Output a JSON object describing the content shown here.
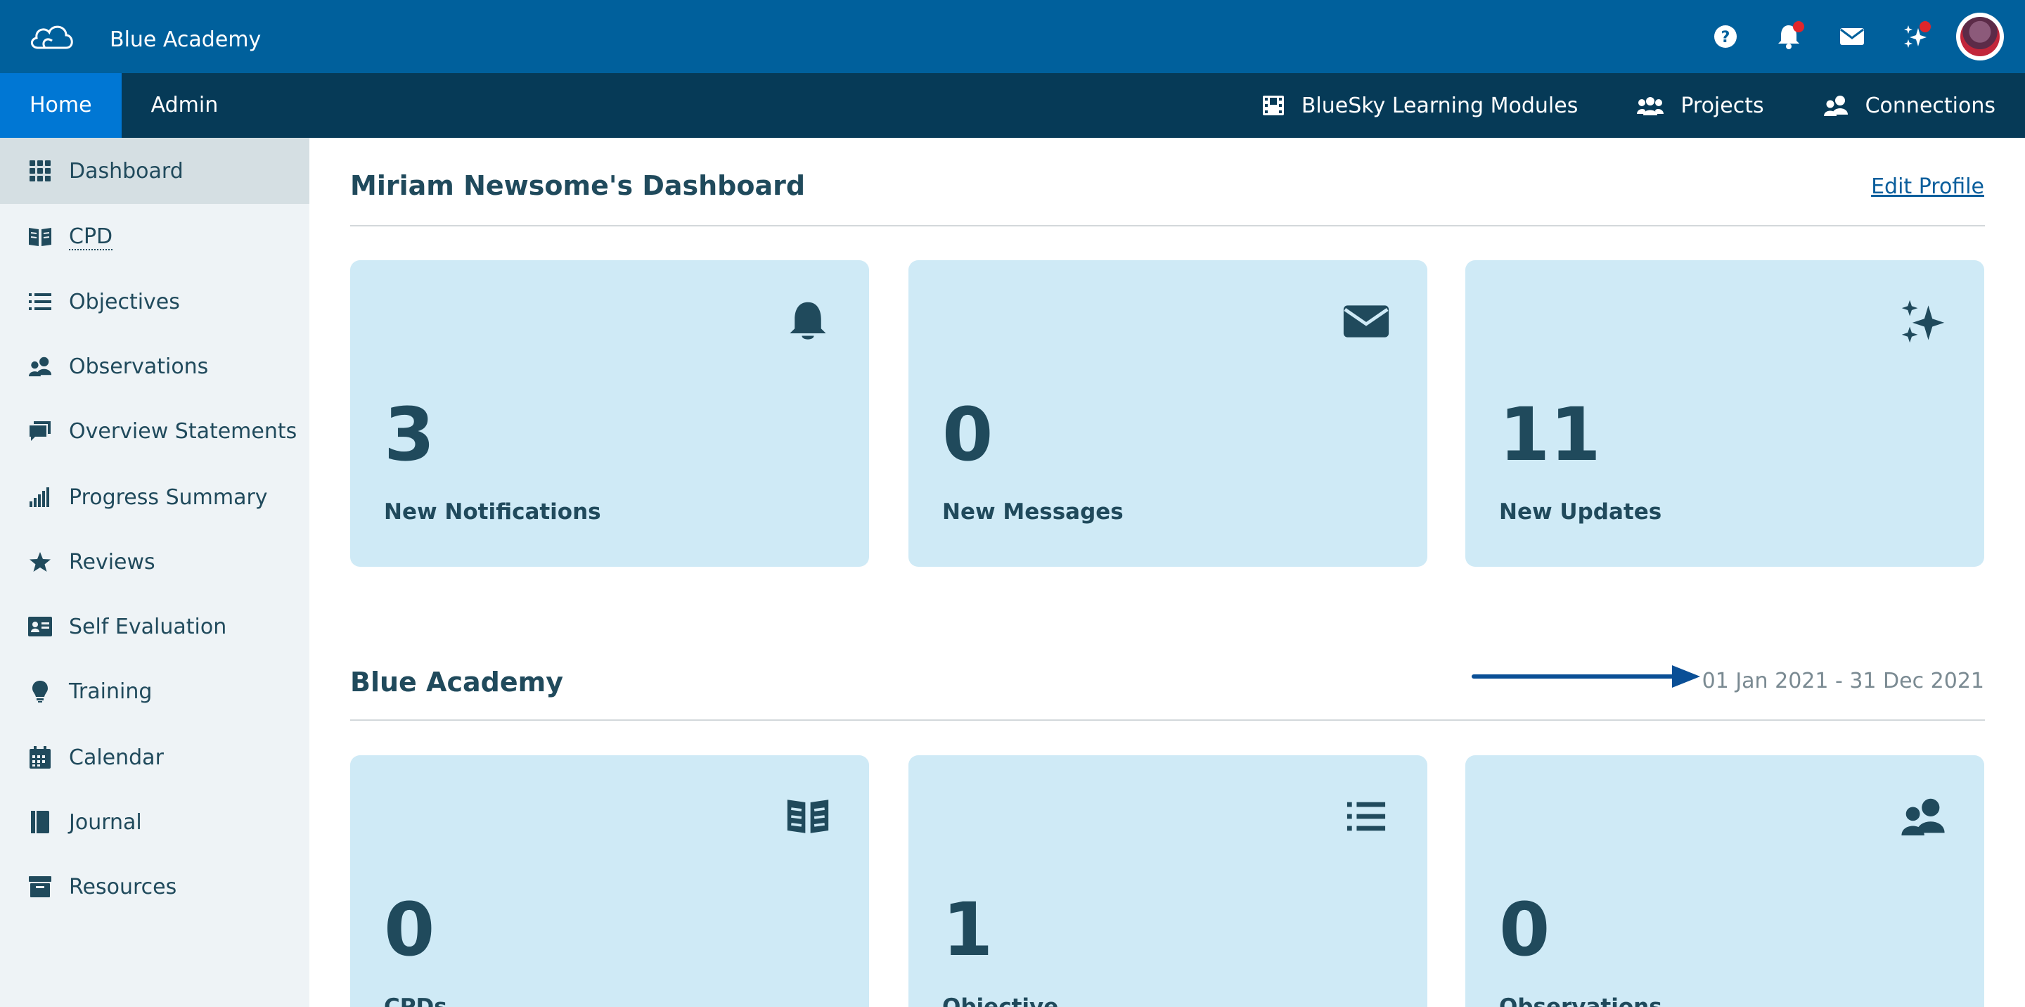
{
  "app": {
    "title": "Blue Academy"
  },
  "nav": {
    "left_tabs": [
      {
        "label": "Home",
        "active": true
      },
      {
        "label": "Admin",
        "active": false
      }
    ],
    "right_links": [
      {
        "label": "BlueSky Learning Modules",
        "icon": "film-icon"
      },
      {
        "label": "Projects",
        "icon": "group-icon"
      },
      {
        "label": "Connections",
        "icon": "people-icon"
      }
    ]
  },
  "top_icons": [
    {
      "icon": "help-icon",
      "badge": false
    },
    {
      "icon": "bell-icon",
      "badge": true
    },
    {
      "icon": "envelope-icon",
      "badge": false
    },
    {
      "icon": "sparkles-icon",
      "badge": true
    },
    {
      "icon": "avatar"
    }
  ],
  "sidebar": {
    "items": [
      {
        "label": "Dashboard",
        "icon": "grid-icon",
        "active": true
      },
      {
        "label": "CPD",
        "icon": "book-icon"
      },
      {
        "label": "Objectives",
        "icon": "list-icon"
      },
      {
        "label": "Observations",
        "icon": "people-icon"
      },
      {
        "label": "Overview Statements",
        "icon": "comments-icon"
      },
      {
        "label": "Progress Summary",
        "icon": "signal-icon"
      },
      {
        "label": "Reviews",
        "icon": "star-icon"
      },
      {
        "label": "Self Evaluation",
        "icon": "id-card-icon"
      },
      {
        "label": "Training",
        "icon": "lightbulb-icon"
      },
      {
        "label": "Calendar",
        "icon": "calendar-icon"
      },
      {
        "label": "Journal",
        "icon": "journal-icon"
      },
      {
        "label": "Resources",
        "icon": "archive-icon"
      }
    ]
  },
  "dashboard": {
    "title": "Miriam Newsome's Dashboard",
    "edit_profile": "Edit Profile",
    "cards": [
      {
        "value": "3",
        "label": "New Notifications",
        "icon": "bell-icon"
      },
      {
        "value": "0",
        "label": "New Messages",
        "icon": "envelope-icon"
      },
      {
        "value": "11",
        "label": "New Updates",
        "icon": "sparkles-icon"
      }
    ]
  },
  "academy": {
    "title": "Blue Academy",
    "date_range": "01 Jan 2021 - 31 Dec 2021",
    "cards": [
      {
        "value": "0",
        "label": "CPDs",
        "icon": "book-icon"
      },
      {
        "value": "1",
        "label": "Objective",
        "icon": "list-icon"
      },
      {
        "value": "0",
        "label": "Observations",
        "icon": "people-icon"
      }
    ]
  },
  "colors": {
    "topbar": "#00609c",
    "navbar": "#063a57",
    "nav_active": "#0077d4",
    "card_bg": "#cfeaf6",
    "text": "#204a5c",
    "badge": "#e0262b"
  }
}
